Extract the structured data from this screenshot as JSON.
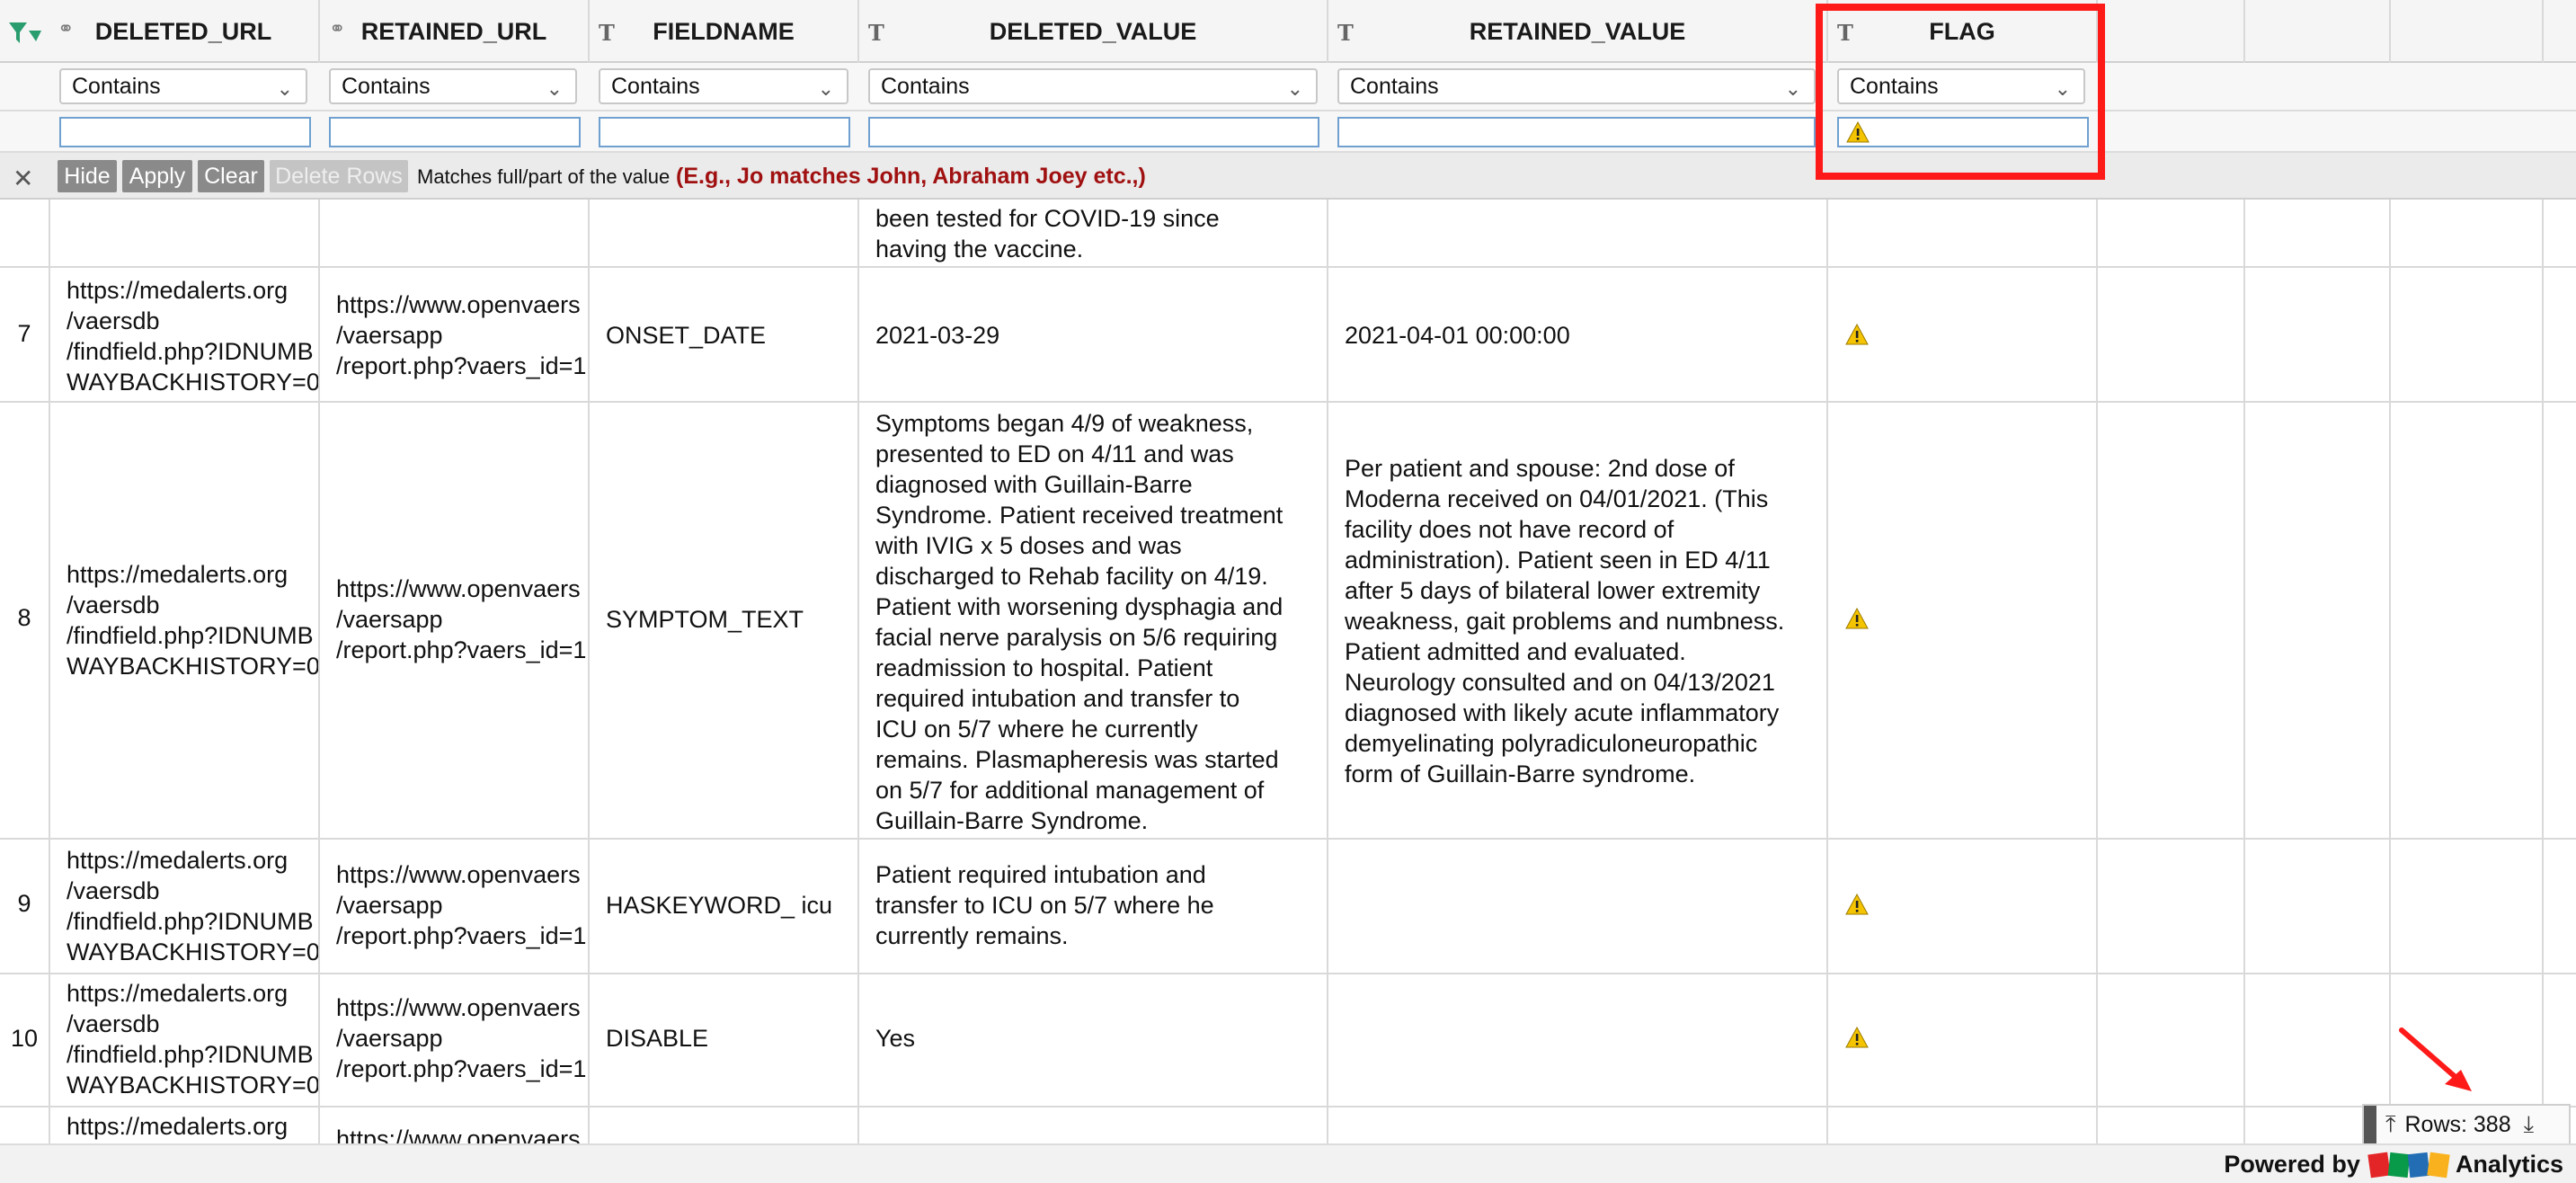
{
  "columns": [
    {
      "name": "DELETED_URL",
      "type_icon": "link-icon"
    },
    {
      "name": "RETAINED_URL",
      "type_icon": "link-icon"
    },
    {
      "name": "FIELDNAME",
      "type_icon": "text-type-icon"
    },
    {
      "name": "DELETED_VALUE",
      "type_icon": "text-type-icon"
    },
    {
      "name": "RETAINED_VALUE",
      "type_icon": "text-type-icon"
    },
    {
      "name": "FLAG",
      "type_icon": "text-type-icon"
    }
  ],
  "filters": {
    "operator": "Contains",
    "flag_value": "⚠️"
  },
  "actions": {
    "hide": "Hide",
    "apply": "Apply",
    "clear": "Clear",
    "delete_rows": "Delete Rows",
    "hint": "Matches full/part of the value",
    "example": "(E.g., Jo matches John, Abraham Joey etc.,)"
  },
  "rows": [
    {
      "num": "",
      "deleted_url": "",
      "retained_url": "",
      "fieldname": "",
      "deleted_value": "been tested for COVID-19 since\nhaving the vaccine.",
      "retained_value": "",
      "flag": false
    },
    {
      "num": "7",
      "deleted_url": "https://medalerts.org\n/vaersdb\n/findfield.php?IDNUMB\nWAYBACKHISTORY=0",
      "retained_url": "https://www.openvaers\n/vaersapp\n/report.php?vaers_id=1",
      "fieldname": "ONSET_DATE",
      "deleted_value": "2021-03-29",
      "retained_value": "2021-04-01 00:00:00",
      "flag": true
    },
    {
      "num": "8",
      "deleted_url": "https://medalerts.org\n/vaersdb\n/findfield.php?IDNUMB\nWAYBACKHISTORY=0",
      "retained_url": "https://www.openvaers\n/vaersapp\n/report.php?vaers_id=1",
      "fieldname": "SYMPTOM_TEXT",
      "deleted_value": "Symptoms began 4/9 of weakness,\npresented to ED on 4/11 and was\ndiagnosed with Guillain-Barre\nSyndrome. Patient received treatment\nwith IVIG x 5 doses and was\ndischarged to Rehab facility on 4/19.\nPatient with worsening dysphagia and\nfacial nerve paralysis on 5/6 requiring\nreadmission to hospital. Patient\nrequired intubation and transfer to\nICU on 5/7 where he currently\nremains. Plasmapheresis was started\non 5/7 for additional management of\nGuillain-Barre Syndrome.",
      "retained_value": "Per patient and spouse: 2nd dose of\nModerna received on 04/01/2021. (This\nfacility does not have record of\nadministration). Patient seen in ED 4/11\nafter 5 days of  bilateral lower extremity\nweakness, gait problems and numbness.\nPatient admitted and evaluated.\nNeurology consulted and on 04/13/2021\ndiagnosed with likely acute inflammatory\ndemyelinating polyradiculoneuropathic\nform of Guillain-Barre syndrome.",
      "flag": true
    },
    {
      "num": "9",
      "deleted_url": "https://medalerts.org\n/vaersdb\n/findfield.php?IDNUMB\nWAYBACKHISTORY=0",
      "retained_url": "https://www.openvaers\n/vaersapp\n/report.php?vaers_id=1",
      "fieldname": "HASKEYWORD_ icu",
      "deleted_value": "Patient required intubation and\ntransfer to ICU on 5/7 where he\ncurrently remains.",
      "retained_value": "",
      "flag": true
    },
    {
      "num": "10",
      "deleted_url": "https://medalerts.org\n/vaersdb\n/findfield.php?IDNUMB\nWAYBACKHISTORY=0",
      "retained_url": "https://www.openvaers\n/vaersapp\n/report.php?vaers_id=1",
      "fieldname": "DISABLE",
      "deleted_value": "Yes",
      "retained_value": "",
      "flag": true
    },
    {
      "num": "",
      "deleted_url": "https://medalerts.org",
      "retained_url": "https://www.openvaers",
      "fieldname": "",
      "deleted_value": "",
      "retained_value": "",
      "flag": false
    }
  ],
  "footer": {
    "rows_label": "Rows: 388",
    "powered_by": "Powered by",
    "brand": "ZOHO",
    "product": "Analytics"
  },
  "colors": {
    "highlight": "#ff1a1a",
    "example_text": "#a01010",
    "warning": "#f5c400"
  }
}
